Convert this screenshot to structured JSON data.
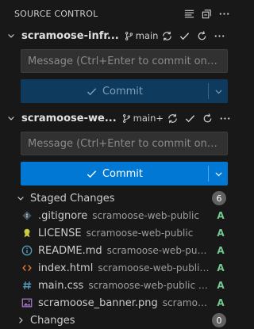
{
  "header": {
    "title": "SOURCE CONTROL"
  },
  "repos": [
    {
      "name": "scramoose-infr...",
      "branch": "main",
      "message_placeholder": "Message (Ctrl+Enter to commit on \"mai...",
      "commit_label": "Commit",
      "commit_enabled": false
    },
    {
      "name": "scramoose-we...",
      "branch": "main+",
      "message_placeholder": "Message (Ctrl+Enter to commit on \"mai...",
      "commit_label": "Commit",
      "commit_enabled": true
    }
  ],
  "staged": {
    "label": "Staged Changes",
    "count": "6",
    "files": [
      {
        "name": ".gitignore",
        "desc": "scramoose-web-public",
        "status": "A",
        "icon": "git-icon",
        "color": "#41535b"
      },
      {
        "name": "LICENSE",
        "desc": "scramoose-web-public",
        "status": "A",
        "icon": "license-icon",
        "color": "#cbcb41"
      },
      {
        "name": "README.md",
        "desc": "scramoose-web-public",
        "status": "A",
        "icon": "info-icon",
        "color": "#519aba"
      },
      {
        "name": "index.html",
        "desc": "scramoose-web-public • src",
        "status": "A",
        "icon": "html-icon",
        "color": "#e37933"
      },
      {
        "name": "main.css",
        "desc": "scramoose-web-public • src/css",
        "status": "A",
        "icon": "css-icon",
        "color": "#519aba"
      },
      {
        "name": "scramoose_banner.png",
        "desc": "scramoose-...",
        "status": "A",
        "icon": "image-icon",
        "color": "#a074c4"
      }
    ]
  },
  "changes": {
    "label": "Changes",
    "count": "0"
  }
}
